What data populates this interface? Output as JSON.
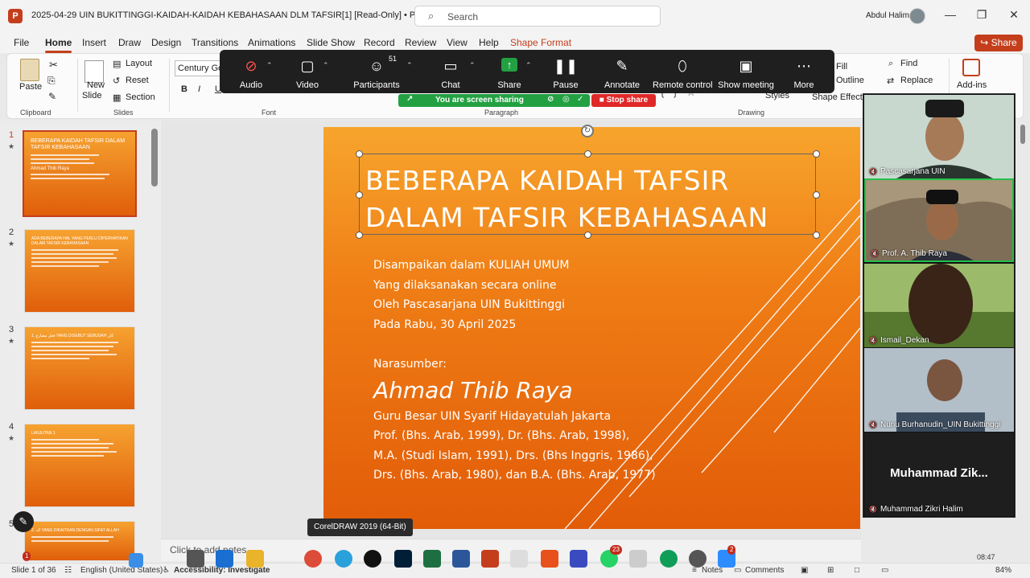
{
  "titlebar": {
    "app_logo": "P",
    "doc_title": "2025-04-29  UIN BUKITTINGGI-KAIDAH-KAIDAH KEBAHASAAN DLM TAFSIR[1] [Read-Only]  •  PowerP...",
    "search_placeholder": "Search",
    "user_name": "Abdul Halim",
    "minimize": "—",
    "restore": "❐",
    "close": "✕"
  },
  "menu": {
    "items": [
      "File",
      "Home",
      "Insert",
      "Draw",
      "Design",
      "Transitions",
      "Animations",
      "Slide Show",
      "Record",
      "Review",
      "View",
      "Help",
      "Shape Format"
    ],
    "share": "Share",
    "share_icon": "share-icon"
  },
  "ribbon": {
    "clipboard": {
      "paste": "Paste",
      "group": "Clipboard"
    },
    "slides": {
      "new_slide_1": "New",
      "new_slide_2": "Slide",
      "layout": "Layout",
      "reset": "Reset",
      "section": "Section",
      "group": "Slides"
    },
    "font": {
      "font_name": "Century Got",
      "bold": "B",
      "italic": "I",
      "underline": "U",
      "group": "Font"
    },
    "paragraph": {
      "group": "Paragraph"
    },
    "drawing": {
      "styles": "Styles",
      "shape_effects": "Shape Effects",
      "shape_fill": "Fill",
      "shape_outline": "Outline",
      "group": "Drawing"
    },
    "editing": {
      "find": "Find",
      "replace": "Replace"
    },
    "addins": {
      "label": "Add-ins"
    }
  },
  "zoom_toolbar": {
    "items": [
      {
        "label": "Audio",
        "icon": "mic-muted-icon"
      },
      {
        "label": "Video",
        "icon": "video-camera-icon"
      },
      {
        "label": "Participants",
        "icon": "participants-icon",
        "count": "51"
      },
      {
        "label": "Chat",
        "icon": "chat-icon"
      },
      {
        "label": "Share",
        "icon": "share-screen-icon"
      },
      {
        "label": "Pause",
        "icon": "pause-icon"
      },
      {
        "label": "Annotate",
        "icon": "pen-icon"
      },
      {
        "label": "Remote control",
        "icon": "mouse-icon"
      },
      {
        "label": "Show meeting",
        "icon": "meeting-window-icon"
      },
      {
        "label": "More",
        "icon": "more-icon"
      }
    ],
    "sharing_banner": "You are screen sharing",
    "stop_share": "Stop share"
  },
  "slide_panel": {
    "thumbnails": [
      {
        "num": "1",
        "title": "BEBERAPA KAIDAH TAFSIR DALAM TAFSIR KEBAHASAAN",
        "sub": "Ahmad Thib Raya"
      },
      {
        "num": "2",
        "title": "ADA BEBERAPA HAL YANG PERLU DIPERHATIKAN DALAM TAFSIR KEBAHASAAN",
        "sub": ""
      },
      {
        "num": "3",
        "title": "1. فعل مضارع YANG DISEBUT SEBUDAH كان",
        "sub": ""
      },
      {
        "num": "4",
        "title": "LANJUTAN 1",
        "sub": ""
      },
      {
        "num": "5",
        "title": "2. اله YANG DIKAITKAN DENGAN SIFAT ALLAH",
        "sub": ""
      }
    ]
  },
  "slide": {
    "title_line1": "BEBERAPA KAIDAH TAFSIR",
    "title_line2": "DALAM TAFSIR KEBAHASAAN",
    "body": [
      "Disampaikan dalam KULIAH UMUM",
      "Yang dilaksanakan secara online",
      "Oleh Pascasarjana UIN Bukittinggi",
      "Pada Rabu, 30 April 2025"
    ],
    "speaker_label": "Narasumber:",
    "speaker_name": "Ahmad Thib Raya",
    "bio": [
      "Guru Besar UIN Syarif Hidayatulah Jakarta",
      "Prof. (Bhs. Arab, 1999), Dr. (Bhs. Arab, 1998),",
      "M.A. (Studi Islam, 1991), Drs. (Bhs Inggris, 1986),",
      "Drs. (Bhs. Arab, 1980), dan B.A. (Bhs. Arab, 1977)"
    ],
    "notes_placeholder": "Click to add notes",
    "tooltip": "CorelDRAW 2019 (64-Bit)"
  },
  "video_panel": {
    "tiles": [
      {
        "name": "Pascasarjana UIN",
        "bg": "#b7c9c0"
      },
      {
        "name": "Prof. A. Thib Raya",
        "bg": "#9a8d72"
      },
      {
        "name": "Ismail_Dekan",
        "bg": "#6c8a4a"
      },
      {
        "name": "Nunu Burhanudin_UIN Bukittinggi",
        "bg": "#8a9aa8"
      },
      {
        "name": "Muhammad Zikri Halim",
        "bg": "#1e1e1e",
        "big": "Muhammad  Zik..."
      }
    ]
  },
  "statusbar": {
    "slide_of": "Slide 1 of 36",
    "language": "English (United States)",
    "accessibility": "Accessibility: Investigate",
    "notes": "Notes",
    "comments": "Comments",
    "zoom": "84%",
    "time": "08:47"
  },
  "taskbar": {
    "badges": {
      "whatsapp": "23",
      "notify": "2",
      "start_badge": "1"
    }
  },
  "colors": {
    "accent": "#c43e1c",
    "zoom_green": "#23a042",
    "slide_orange_top": "#f7a52d",
    "slide_orange_bottom": "#e25c08"
  }
}
